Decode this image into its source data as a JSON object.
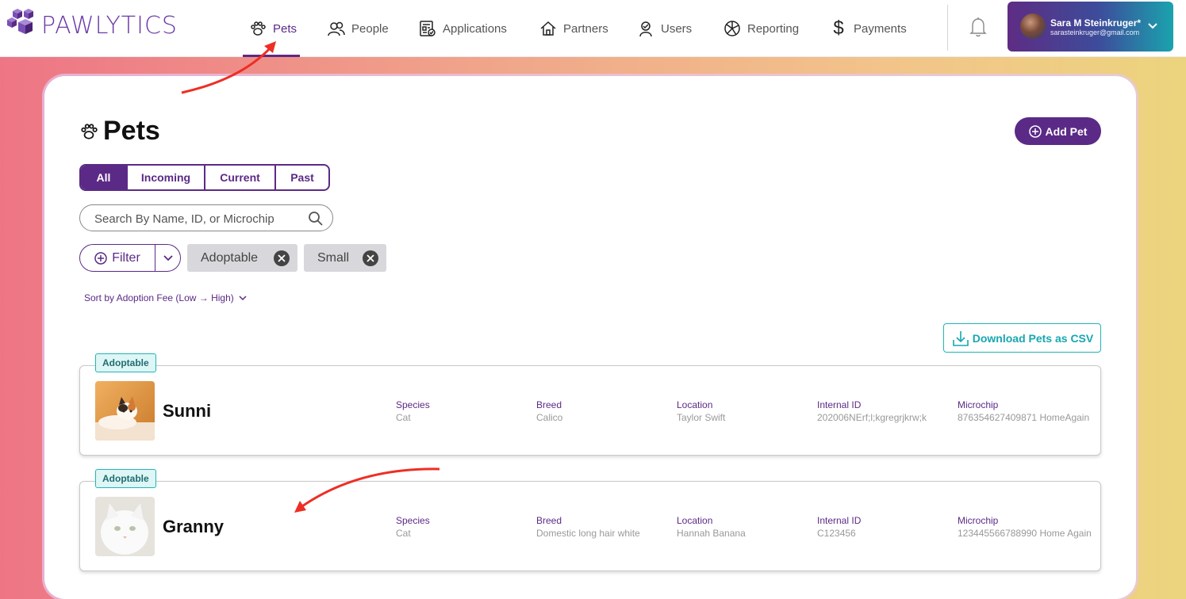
{
  "app": {
    "logo_text": "PAWLYTICS"
  },
  "nav": [
    {
      "label": "Pets",
      "icon": "paw-icon"
    },
    {
      "label": "People",
      "icon": "people-icon"
    },
    {
      "label": "Applications",
      "icon": "applications-icon"
    },
    {
      "label": "Partners",
      "icon": "home-icon"
    },
    {
      "label": "Users",
      "icon": "user-badge-icon"
    },
    {
      "label": "Reporting",
      "icon": "reporting-icon"
    },
    {
      "label": "Payments",
      "icon": "dollar-icon"
    }
  ],
  "user": {
    "name": "Sara M Steinkruger*",
    "email": "sarasteinkruger@gmail.com"
  },
  "page": {
    "title": "Pets",
    "add_button": "Add Pet"
  },
  "tabs": [
    {
      "label": "All",
      "active": true
    },
    {
      "label": "Incoming",
      "active": false
    },
    {
      "label": "Current",
      "active": false
    },
    {
      "label": "Past",
      "active": false
    }
  ],
  "search": {
    "placeholder": "Search By Name, ID, or Microchip",
    "value": ""
  },
  "filter": {
    "label": "Filter",
    "chips": [
      "Adoptable",
      "Small"
    ]
  },
  "sort": {
    "label": "Sort by Adoption Fee (Low → High)"
  },
  "csv_button": "Download Pets as CSV",
  "columns": {
    "species": "Species",
    "breed": "Breed",
    "location": "Location",
    "internal_id": "Internal ID",
    "microchip": "Microchip"
  },
  "pets": [
    {
      "badge": "Adoptable",
      "name": "Sunni",
      "species": "Cat",
      "breed": "Calico",
      "location": "Taylor Swift",
      "internal_id": "202006NErf;l;kgregrjkrw;k",
      "microchip": "876354627409871 HomeAgain"
    },
    {
      "badge": "Adoptable",
      "name": "Granny",
      "species": "Cat",
      "breed": "Domestic long hair white",
      "location": "Hannah Banana",
      "internal_id": "C123456",
      "microchip": "123445566788990 Home Again"
    }
  ],
  "colors": {
    "brand": "#5b2a86",
    "teal": "#1fb5b5",
    "annotation": "#ee2e24"
  }
}
